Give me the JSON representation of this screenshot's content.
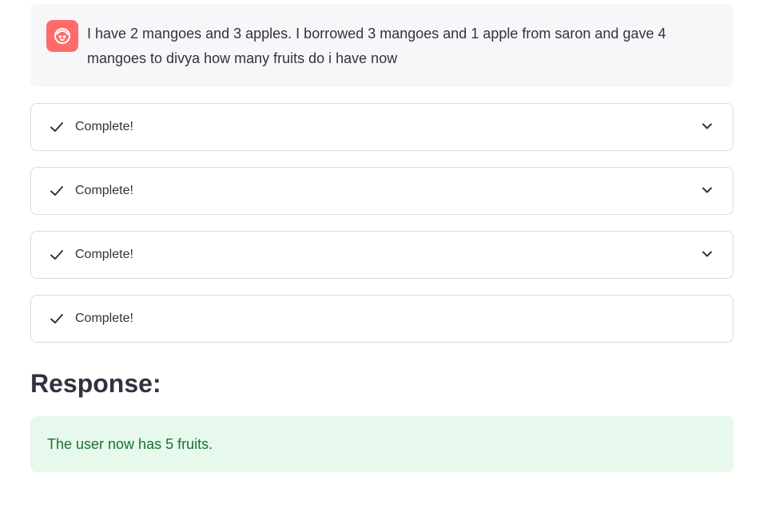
{
  "chat": {
    "avatar_icon": "user-face-icon",
    "avatar_color": "#ff6b6b",
    "message": "I have 2 mangoes and 3 apples. I borrowed 3 mangoes and 1 apple from saron and gave 4 mangoes to divya how many fruits do i have now"
  },
  "steps": [
    {
      "label": "Complete!",
      "status_icon": "check-icon",
      "expandable": true
    },
    {
      "label": "Complete!",
      "status_icon": "check-icon",
      "expandable": true
    },
    {
      "label": "Complete!",
      "status_icon": "check-icon",
      "expandable": true
    },
    {
      "label": "Complete!",
      "status_icon": "check-icon",
      "expandable": false
    }
  ],
  "response": {
    "heading": "Response:",
    "text": "The user now has 5 fruits.",
    "box_color": "#e7f8ec",
    "text_color": "#177233"
  }
}
